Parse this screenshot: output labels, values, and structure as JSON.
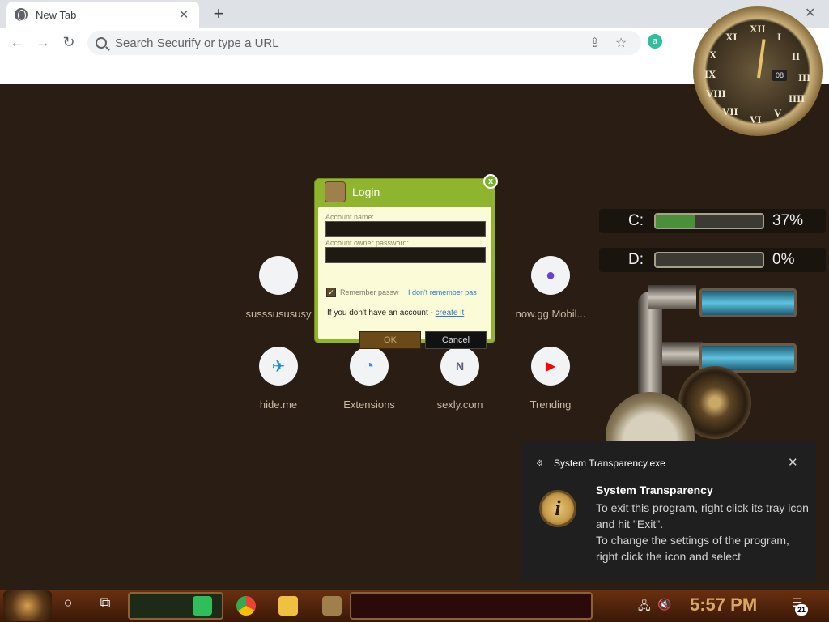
{
  "browser": {
    "tab_title": "New Tab",
    "tab_close": "✕",
    "new_tab": "+",
    "window_close": "✕",
    "omnibox_placeholder": "Search Securify or type a URL",
    "extension_badge": "a"
  },
  "shortcuts": [
    {
      "label": "susssusususy",
      "icon": "blank-icon",
      "glyph": ""
    },
    {
      "label": "now.gg Mobil...",
      "icon": "nowgg-icon",
      "glyph": "●"
    },
    {
      "label": "hide.me",
      "icon": "hideme-icon",
      "glyph": "✈"
    },
    {
      "label": "Extensions",
      "icon": "extensions-icon",
      "glyph": "◔"
    },
    {
      "label": "sexly.com",
      "icon": "sexly-icon",
      "glyph": "N"
    },
    {
      "label": "Trending",
      "icon": "youtube-icon",
      "glyph": "▶"
    }
  ],
  "login": {
    "title": "Login",
    "close": "x",
    "account_name_label": "Account name:",
    "account_name_value": "",
    "password_label": "Account owner password:",
    "remember_label": "Remember passw",
    "remember_checked": true,
    "check_glyph": "✓",
    "forgot_link": "I don't remember pas",
    "no_account_text": "If you don't have an account - ",
    "create_link": "create it",
    "ok_label": "OK",
    "cancel_label": "Cancel"
  },
  "clock": {
    "numerals": [
      "XII",
      "I",
      "II",
      "III",
      "IIII",
      "V",
      "VI",
      "VII",
      "VIII",
      "IX",
      "X",
      "XI"
    ],
    "date": "08"
  },
  "drives": [
    {
      "letter": "C:",
      "percent_text": "37%",
      "fill_fraction": 0.37
    },
    {
      "letter": "D:",
      "percent_text": "0%",
      "fill_fraction": 0.0
    }
  ],
  "notification": {
    "app_name": "System Transparency.exe",
    "close": "✕",
    "icon_glyph": "i",
    "title": "System Transparency",
    "line1": "To exit this program, right click its tray icon and hit \"Exit\".",
    "line2": "To change the settings of the program, right click the icon and select"
  },
  "taskbar": {
    "cortana_glyph": "○",
    "taskview_glyph": "⧉",
    "time": "5:57 PM",
    "notification_count": "21",
    "tray_network": "🖧",
    "tray_volume": "🔇"
  },
  "colors": {
    "page_bg": "#2a1d14",
    "login_green": "#8fb52f",
    "clock_gold": "#d9a860",
    "youtube_red": "#ff0000"
  }
}
